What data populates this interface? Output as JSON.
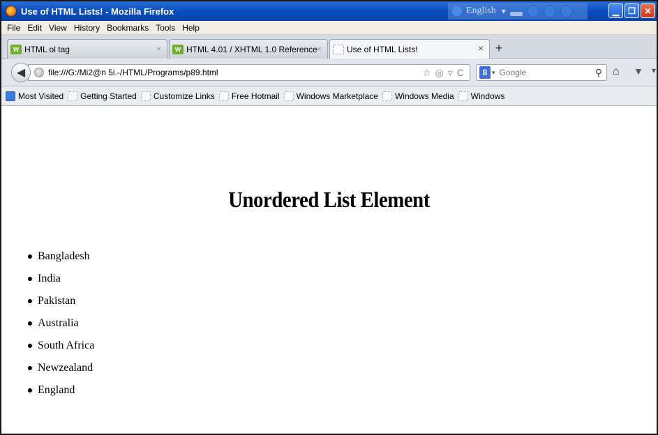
{
  "window": {
    "title": "Use of HTML Lists! - Mozilla Firefox",
    "language_bar": "English"
  },
  "menu": [
    "File",
    "Edit",
    "View",
    "History",
    "Bookmarks",
    "Tools",
    "Help"
  ],
  "tabs": [
    {
      "label": "HTML ol tag",
      "favicon": "w3-icon"
    },
    {
      "label": "HTML 4.01 / XHTML 1.0 Reference",
      "favicon": "w3-icon"
    },
    {
      "label": "Use of HTML Lists!",
      "favicon": "blank-page-icon",
      "active": true
    }
  ],
  "nav": {
    "url": "file:///G:/Mi2@n 5i.-/HTML/Programs/p89.html",
    "search_placeholder": "Google"
  },
  "bookmarks": [
    "Most Visited",
    "Getting Started",
    "Customize Links",
    "Free Hotmail",
    "Windows Marketplace",
    "Windows Media",
    "Windows"
  ],
  "page": {
    "heading": "Unordered List Element",
    "items": [
      "Bangladesh",
      "India",
      "Pakistan",
      "Australia",
      "South Africa",
      "Newzealand",
      "England"
    ]
  },
  "colors": {
    "titlebar": "#0b4fc2",
    "menubar": "#f1ede3",
    "tabstrip": "#d6dae2"
  }
}
